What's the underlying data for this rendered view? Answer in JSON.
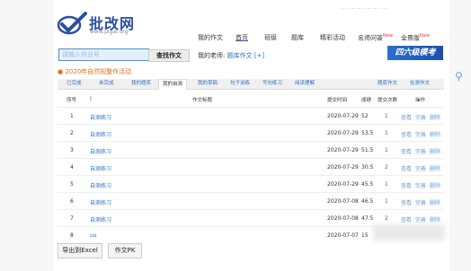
{
  "logo": {
    "text": "批改网",
    "url": "www.pigai.org"
  },
  "topbar": {
    "text": "··· · ·· ··· · ·· ··· · ···"
  },
  "nav": [
    {
      "label": "我的作文",
      "new": ""
    },
    {
      "label": "首页",
      "new": ""
    },
    {
      "label": "班级",
      "new": ""
    },
    {
      "label": "题库",
      "new": ""
    },
    {
      "label": "精彩活动",
      "new": ""
    },
    {
      "label": "名师问答",
      "new": "New"
    },
    {
      "label": "全景版",
      "new": "New"
    }
  ],
  "search": {
    "placeholder": "请输入作业号",
    "button": "查找作文"
  },
  "teacher": {
    "label": "我的老师:",
    "link": "题库作文",
    "extra": "[+]"
  },
  "banner": "四六级模考",
  "notice": "2020年自然规整作活动",
  "tabs": [
    "已完成",
    "未完成",
    "我的题库",
    "我的自测",
    "我的草稿",
    "句子训练",
    "写句练习",
    "阅读理解"
  ],
  "tabs_right": [
    "题库作文",
    "在测作文"
  ],
  "table": {
    "headers": [
      "序号",
      "|",
      "作文标题",
      "提交时间",
      "成绩",
      "提交次数",
      "操作"
    ],
    "rows": [
      {
        "no": "1",
        "title": "自测练习",
        "date": "2020-07-29",
        "score": "52",
        "count": "1",
        "a1": "查看",
        "a2": "完善",
        "a3": "删除"
      },
      {
        "no": "2",
        "title": "自测练习",
        "date": "2020-07-29",
        "score": "53.5",
        "count": "1",
        "a1": "查看",
        "a2": "完善",
        "a3": "删除"
      },
      {
        "no": "3",
        "title": "自测练习",
        "date": "2020-07-29",
        "score": "51.5",
        "count": "1",
        "a1": "查看",
        "a2": "完善",
        "a3": "删除"
      },
      {
        "no": "4",
        "title": "自测练习",
        "date": "2020-07-29",
        "score": "30.5",
        "count": "2",
        "a1": "查看",
        "a2": "完善",
        "a3": "删除"
      },
      {
        "no": "5",
        "title": "自测练习",
        "date": "2020-07-29",
        "score": "45.5",
        "count": "1",
        "a1": "查看",
        "a2": "完善",
        "a3": "删除"
      },
      {
        "no": "6",
        "title": "自测练习",
        "date": "2020-07-08",
        "score": "46.5",
        "count": "1",
        "a1": "查看",
        "a2": "完善",
        "a3": "删除"
      },
      {
        "no": "7",
        "title": "自测练习",
        "date": "2020-07-08",
        "score": "47.5",
        "count": "2",
        "a1": "查看",
        "a2": "完善",
        "a3": "删除"
      },
      {
        "no": "8",
        "title": "uu",
        "date": "2020-07-07",
        "score": "15",
        "count": "",
        "a1": "",
        "a2": "",
        "a3": ""
      }
    ]
  },
  "bottom": {
    "export": "导出到Excel",
    "pk": "作文PK"
  },
  "colors": {
    "brand": "#2b4fa0",
    "link": "#2b6fc0",
    "notice": "#e0731a",
    "banner": "#1c4fb0"
  }
}
